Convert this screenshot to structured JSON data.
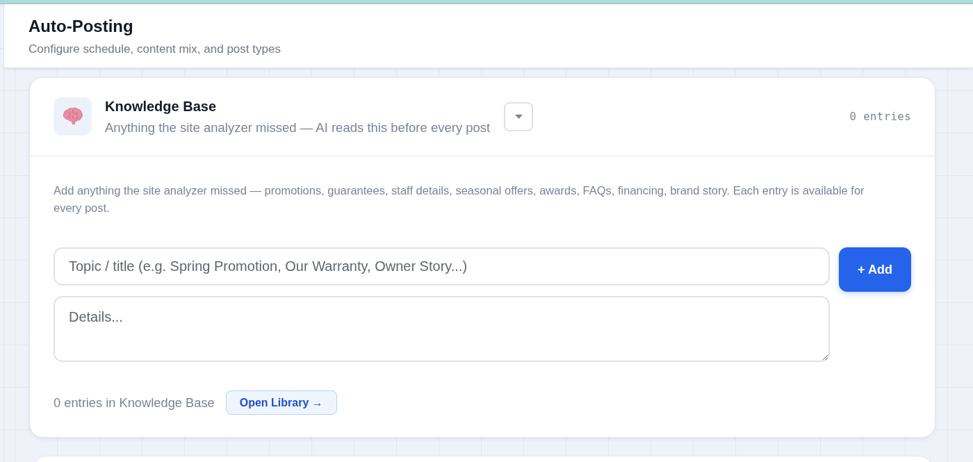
{
  "header": {
    "title": "Auto-Posting",
    "subtitle": "Configure schedule, content mix, and post types"
  },
  "knowledge_base": {
    "title": "Knowledge Base",
    "subtitle": "Anything the site analyzer missed — AI reads this before every post",
    "expanded": true,
    "entry_count": "0 entries",
    "description": "Add anything the site analyzer missed — promotions, guarantees, staff details, seasonal offers, awards, FAQs, financing, brand story. Each entry is available for every post.",
    "topic_field": {
      "placeholder": "Topic / title (e.g. Spring Promotion, Our Warranty, Owner Story...)"
    },
    "details_field": {
      "placeholder": "Details..."
    },
    "add_button": "+ Add",
    "footer_text": "0 entries in Knowledge Base",
    "library_button": "Open Library →"
  }
}
